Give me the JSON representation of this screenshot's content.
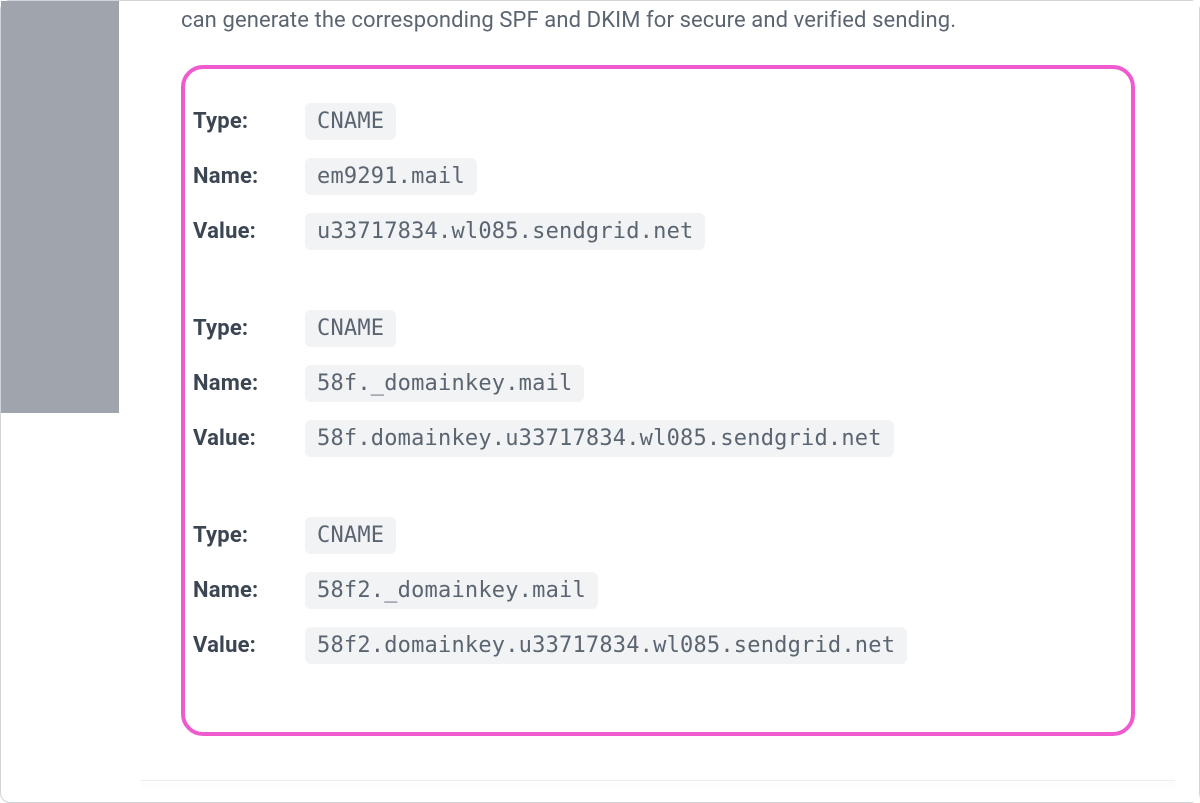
{
  "intro": "can generate the corresponding SPF and DKIM for secure and verified sending.",
  "labels": {
    "type": "Type:",
    "name": "Name:",
    "value": "Value:"
  },
  "records": [
    {
      "type": "CNAME",
      "name": "em9291.mail",
      "value": "u33717834.wl085.sendgrid.net"
    },
    {
      "type": "CNAME",
      "name": "58f._domainkey.mail",
      "value": "58f.domainkey.u33717834.wl085.sendgrid.net"
    },
    {
      "type": "CNAME",
      "name": "58f2._domainkey.mail",
      "value": "58f2.domainkey.u33717834.wl085.sendgrid.net"
    }
  ]
}
